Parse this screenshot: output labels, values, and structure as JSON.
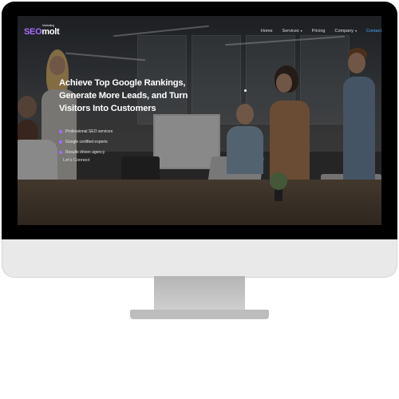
{
  "site": {
    "logo": {
      "brand_main": "SEO",
      "brand_suffix": "molt",
      "tagline": "Marketing"
    },
    "nav": {
      "items": [
        {
          "label": "Home",
          "has_dropdown": false
        },
        {
          "label": "Services",
          "has_dropdown": true
        },
        {
          "label": "Pricing",
          "has_dropdown": false
        },
        {
          "label": "Company",
          "has_dropdown": true
        },
        {
          "label": "Contact",
          "has_dropdown": false
        }
      ]
    },
    "hero": {
      "headline": "Achieve Top Google Rankings, Generate More Leads, and Turn Visitors Into Customers",
      "bullets": [
        "Professional SEO services",
        "Google certified experts",
        "Results driven agency"
      ],
      "cta": "Let's Connect"
    }
  },
  "colors": {
    "accent": "#a56cff",
    "contact_link": "#4aa6ff",
    "bezel": "#000000",
    "chin": "#e9e9e9"
  },
  "icons": {
    "dropdown": "chevron-down-icon",
    "bullet": "dot-icon"
  }
}
